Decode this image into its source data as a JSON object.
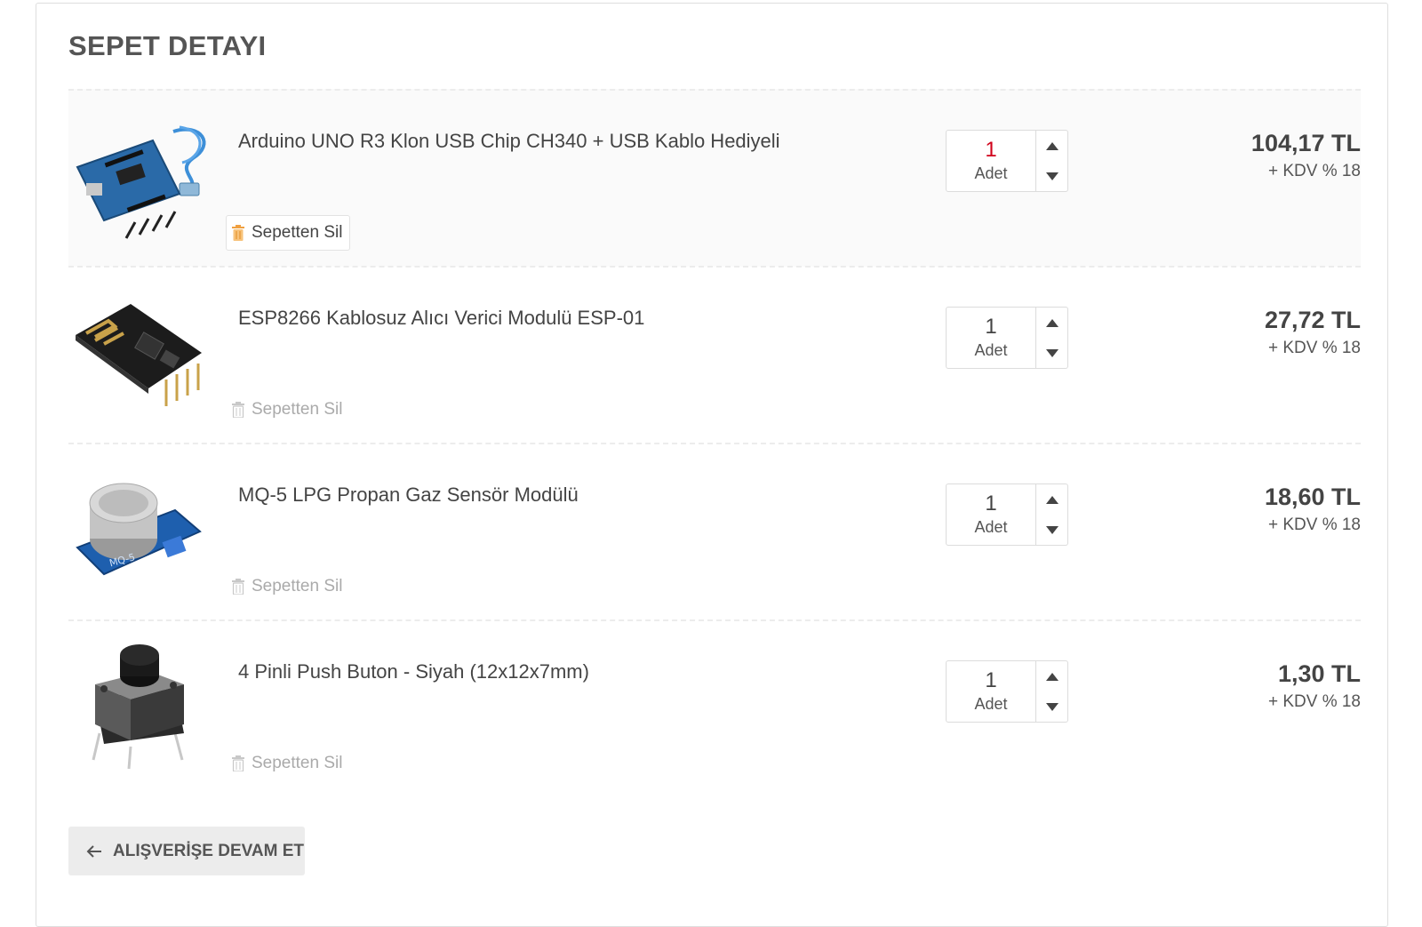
{
  "cart": {
    "title": "SEPET DETAYI",
    "continue_label": "ALIŞVERİŞE DEVAM ET",
    "items": [
      {
        "name": "Arduino UNO R3 Klon USB Chip CH340 + USB Kablo Hediyeli",
        "quantity": "1",
        "unit": "Adet",
        "price": "104,17 TL",
        "vat": "+ KDV % 18",
        "remove_label": "Sepetten Sil",
        "image_icon": "arduino-board-icon"
      },
      {
        "name": "ESP8266 Kablosuz Alıcı Verici Modulü ESP-01",
        "quantity": "1",
        "unit": "Adet",
        "price": "27,72 TL",
        "vat": "+ KDV % 18",
        "remove_label": "Sepetten Sil",
        "image_icon": "esp-module-icon"
      },
      {
        "name": "MQ-5 LPG Propan Gaz Sensör Modülü",
        "quantity": "1",
        "unit": "Adet",
        "price": "18,60 TL",
        "vat": "+ KDV % 18",
        "remove_label": "Sepetten Sil",
        "image_icon": "gas-sensor-icon"
      },
      {
        "name": "4 Pinli Push Buton - Siyah (12x12x7mm)",
        "quantity": "1",
        "unit": "Adet",
        "price": "1,30 TL",
        "vat": "+ KDV % 18",
        "remove_label": "Sepetten Sil",
        "image_icon": "push-button-icon"
      }
    ]
  },
  "colors": {
    "quantity_highlight": "#d0021b",
    "trash_active": "#f0a040",
    "trash_inactive": "#c8c8c8"
  }
}
